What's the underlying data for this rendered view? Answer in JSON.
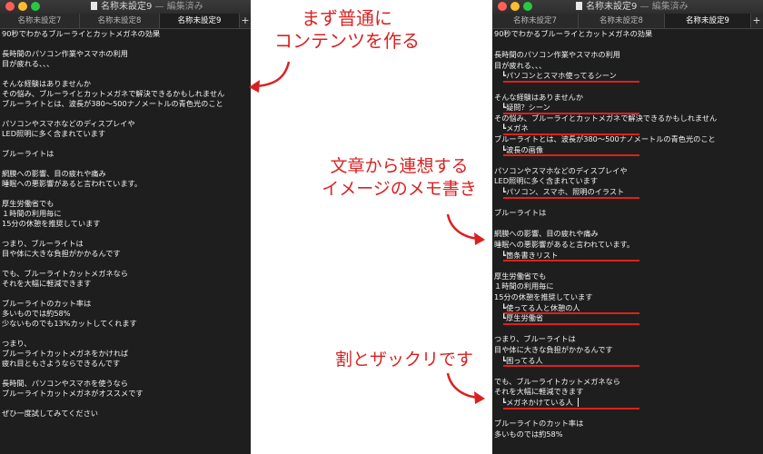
{
  "left_window": {
    "title": "名称未設定9",
    "title_suffix": " — 編集済み",
    "tabs": [
      "名称未設定7",
      "名称未設定8",
      "名称未設定9"
    ],
    "active_tab": 2,
    "new_tab": "+",
    "lines": [
      "90秒でわかるブルーライとカットメガネの効果",
      "",
      "長時間のパソコン作業やスマホの利用",
      "目が疲れる、、、",
      "",
      "そんな経験はありませんか",
      "その悩み、ブルーライとカットメガネで解決できるかもしれません",
      "ブルーライトとは、波長が380〜500ナノメートルの青色光のこと",
      "",
      "パソコンやスマホなどのディスプレイや",
      "LED照明に多く含まれています",
      "",
      "ブルーライトは",
      "",
      "網膜への影響、目の疲れや痛み",
      "睡眠への悪影響があると言われています。",
      "",
      "厚生労働省でも",
      "１時間の利用毎に",
      "15分の休憩を推奨しています",
      "",
      "つまり、ブルーライトは",
      "目や体に大きな負担がかかるんです",
      "",
      "でも、ブルーライトカットメガネなら",
      "それを大幅に軽減できます",
      "",
      "ブルーライトのカット率は",
      "多いものでは約58%",
      "少ないものでも13%カットしてくれます",
      "",
      "つまり、",
      "ブルーライトカットメガネをかければ",
      "疲れ目ともさようならできるんです",
      "",
      "長時間、パソコンやスマホを使うなら",
      "ブルーライトカットメガネがオススメです",
      "",
      "ぜひ一度試してみてください"
    ]
  },
  "right_window": {
    "title": "名称未設定9",
    "title_suffix": " — 編集済み",
    "tabs": [
      "名称未設定7",
      "名称未設定8",
      "名称未設定9"
    ],
    "active_tab": 2,
    "new_tab": "+",
    "lines": [
      "90秒でわかるブルーライとカットメガネの効果",
      "",
      "長時間のパソコン作業やスマホの利用",
      "目が疲れる、、、",
      "　┗パソコンとスマホ使ってるシーン",
      "",
      "そんな経験はありませんか",
      "　┗疑問？シーン",
      "その悩み、ブルーライとカットメガネで解決できるかもしれません",
      "　┗メガネ",
      "ブルーライトとは、波長が380〜500ナノメートルの青色光のこと",
      "　┗波長の画像",
      "",
      "パソコンやスマホなどのディスプレイや",
      "LED照明に多く含まれています",
      "　┗パソコン、スマホ、照明のイラスト",
      "",
      "ブルーライトは",
      "",
      "網膜への影響、目の疲れや痛み",
      "睡眠への悪影響があると言われています。",
      "　┗箇条書きリスト",
      "",
      "厚生労働省でも",
      "１時間の利用毎に",
      "15分の休憩を推奨しています",
      "　┗使ってる人と休憩の人",
      "　┗厚生労働省",
      "",
      "つまり、ブルーライトは",
      "目や体に大きな負担がかかるんです",
      "　┗困ってる人",
      "",
      "でも、ブルーライトカットメガネなら",
      "それを大幅に軽減できます",
      "　┗メガネかけている人",
      "",
      "ブルーライトのカット率は",
      "多いものでは約58%"
    ]
  },
  "annotations": {
    "note1": [
      "まず普通に",
      "コンテンツを作る"
    ],
    "note2": [
      "文章から連想する",
      "イメージのメモ書き"
    ],
    "note3": [
      "割とザックリです"
    ],
    "color": "#d92121",
    "underline_color": "#e01f1f"
  }
}
